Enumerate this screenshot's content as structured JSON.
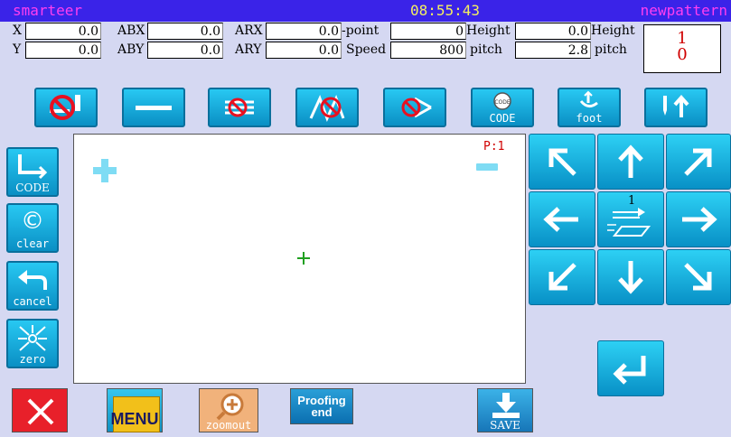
{
  "title": {
    "left": "smarteer",
    "time": "08:55:43",
    "right": "newpattern"
  },
  "info": {
    "x_label": "X",
    "x_value": "0.0",
    "y_label": "Y",
    "y_value": "0.0",
    "abx_label": "ABX",
    "abx_value": "0.0",
    "aby_label": "ABY",
    "aby_value": "0.0",
    "arx_label": "ARX",
    "arx_value": "0.0",
    "ary_label": "ARY",
    "ary_value": "0.0",
    "point_label": "-point",
    "point_value": "0",
    "speed_label": "Speed",
    "speed_value": "800",
    "height1_label": "Height",
    "height1_value": "0.0",
    "pitch_label": "pitch",
    "pitch_value": "2.8",
    "height2_label": "Height",
    "pitch2_label": "pitch",
    "counter_top": "1",
    "counter_bottom": "0"
  },
  "toolbar": {
    "code_label": "CODE",
    "foot_label": "foot"
  },
  "side": {
    "code_label": "CODE",
    "clear_label": "clear",
    "cancel_label": "cancel",
    "zero_label": "zero"
  },
  "canvas": {
    "page_label": "P:1"
  },
  "pad": {
    "center_number": "1"
  },
  "bottom": {
    "menu_label": "MENU",
    "zoomout_label": "zoomout",
    "proofing_label": "Proofing\nend",
    "save_label": "SAVE"
  },
  "colors": {
    "accent": "#3a23e8",
    "button": "#18a8dc",
    "close": "#e8202a",
    "canvas_marker": "#7fdcf4",
    "cursor": "#20a020"
  }
}
